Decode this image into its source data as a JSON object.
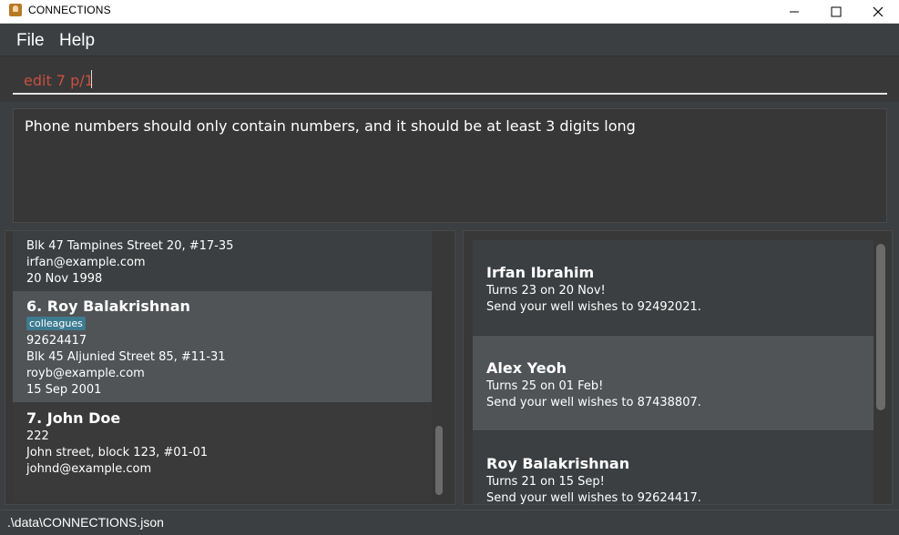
{
  "window": {
    "title": "CONNECTIONS"
  },
  "menu": {
    "items": [
      "File",
      "Help"
    ]
  },
  "command": {
    "value": "edit 7 p/1"
  },
  "result": {
    "text": "Phone numbers should only contain numbers, and it should be at least 3 digits long"
  },
  "persons": [
    {
      "address": "Blk 47 Tampines Street 20, #17-35",
      "email": "irfan@example.com",
      "birthday": "20 Nov 1998"
    },
    {
      "name": "6.  Roy Balakrishnan",
      "tag": "colleagues",
      "phone": "92624417",
      "address": "Blk 45 Aljunied Street 85, #11-31",
      "email": "royb@example.com",
      "birthday": "15 Sep 2001"
    },
    {
      "name": "7.  John Doe",
      "phone": "222",
      "address": "John street, block 123, #01-01",
      "email": "johnd@example.com"
    }
  ],
  "birthdays": [
    {
      "name": "Irfan Ibrahim",
      "turns": "Turns 23 on 20 Nov!",
      "wish": "Send your well wishes to 92492021."
    },
    {
      "name": "Alex Yeoh",
      "turns": "Turns 25 on 01 Feb!",
      "wish": "Send your well wishes to 87438807."
    },
    {
      "name": "Roy Balakrishnan",
      "turns": "Turns 21 on 15 Sep!",
      "wish": "Send your well wishes to 92624417."
    }
  ],
  "status": {
    "path": ".\\data\\CONNECTIONS.json"
  },
  "colors": {
    "accent_error_text": "#c8503e",
    "tag_bg": "#3e7b91",
    "selected_row": "#505457"
  }
}
